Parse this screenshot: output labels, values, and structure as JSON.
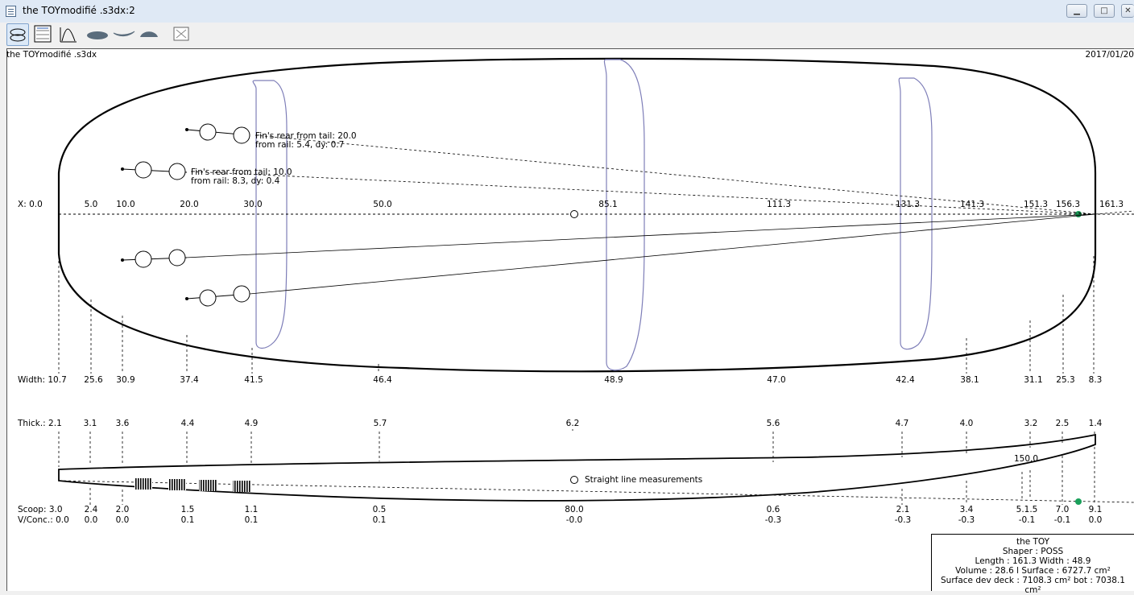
{
  "window": {
    "title": "the TOYmodifié .s3dx:2",
    "controls": [
      "minimize-icon",
      "maximize-icon",
      "close-icon"
    ]
  },
  "toolbar": {
    "tools": [
      "outline-view-icon",
      "table-view-icon",
      "rocker-curve-icon",
      "board-top-icon",
      "board-side-icon",
      "board-slice-icon",
      "export-icon"
    ],
    "active": "outline-view-icon"
  },
  "header": {
    "file": "the TOYmodifié .s3dx",
    "date": "2017/01/20"
  },
  "stations": {
    "positions": [
      "0.0",
      "5.0",
      "10.0",
      "20.0",
      "30.0",
      "50.0",
      "85.1",
      "111.3",
      "131.3",
      "141.3",
      "151.3",
      "156.3",
      "161.3"
    ],
    "x_prefix": "X: ",
    "width_prefix": "Width: ",
    "widths": [
      "10.7",
      "25.6",
      "30.9",
      "37.4",
      "41.5",
      "46.4",
      "48.9",
      "47.0",
      "42.4",
      "38.1",
      "31.1",
      "25.3",
      "8.3"
    ],
    "thick_prefix": "Thick.: ",
    "thicknesses": [
      "2.1",
      "3.1",
      "3.6",
      "4.4",
      "4.9",
      "5.7",
      "6.2",
      "5.6",
      "4.7",
      "4.0",
      "3.2",
      "2.5",
      "1.4"
    ],
    "scoop_prefix": "Scoop: ",
    "scoops": [
      "3.0",
      "2.4",
      "2.0",
      "1.5",
      "1.1",
      "0.5",
      "80.0",
      "0.6",
      "2.1",
      "3.4",
      "5.1.5",
      "7.0",
      "9.1"
    ],
    "conc_prefix": "V/Conc.: ",
    "concaves": [
      "0.0",
      "0.0",
      "0.0",
      "0.1",
      "0.1",
      "0.1",
      "-0.0",
      "-0.3",
      "-0.3",
      "-0.3",
      "-0.1",
      "-0.1",
      "0.0"
    ]
  },
  "fins": {
    "rear_20": {
      "line1": "Fin's rear from tail: 20.0",
      "line2": "from rail: 5.4, dy: 0.7"
    },
    "rear_10": {
      "line1": "Fin's rear from tail: 10.0",
      "line2": "from rail: 8.3, dy: 0.4"
    }
  },
  "profile": {
    "measure_label": "150.0",
    "legend": "Straight line measurements"
  },
  "summary": {
    "name": "the TOY",
    "shaper": "Shaper : POSS",
    "dims": "Length : 161.3 Width  : 48.9",
    "volume": "Volume :  28.6 l  Surface : 6727.7 cm²",
    "surface_dev": "Surface dev deck : 7108.3 cm² bot : 7038.1 cm²"
  },
  "colors": {
    "outline": "#000000",
    "slice": "#7e7eb8",
    "marker": "#1aa05a",
    "titlebar": "#dfe9f5"
  }
}
